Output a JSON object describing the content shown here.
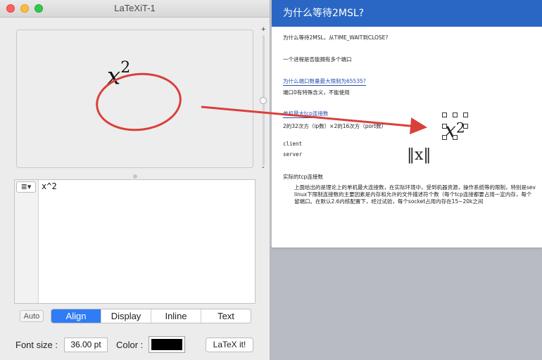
{
  "latexit": {
    "window_title": "LaTeXiT-1",
    "preview_formula_base": "x",
    "preview_formula_exponent": "2",
    "slider_plus": "+",
    "slider_minus": "-",
    "source_code": "x^2",
    "menu_glyph": "≣▾",
    "auto_label": "Auto",
    "modes": [
      "Align",
      "Display",
      "Inline",
      "Text"
    ],
    "active_mode": "Align",
    "font_size_label": "Font size :",
    "font_size_value": "36.00 pt",
    "color_label": "Color :",
    "color_value": "#000000",
    "latex_button": "LaTeX it!"
  },
  "document": {
    "title": "为什么等待2MSL?",
    "lines": {
      "l1": "为什么等待2MSL，从TIME_WAIT到CLOSE?",
      "l2": "一个进程是否能拥有多个端口",
      "l3": "为什么端口数量最大限制为65535?",
      "l4": "端口0有特殊含义，不能使用",
      "l5": "单机最大tcp连接数",
      "l6": "2的32次方（ip数）×2的16次方（port数）",
      "l7": "client",
      "l8": "server",
      "l9": "实际的tcp连接数",
      "p1": "上面给出的是理论上的单机最大连接数，在实际环境中，受到机器资源，操作系统等的限制，特别是sev",
      "p2": "linux下限制连接数的主要因素是内存和允许的文件描述符个数（每个tcp连接都要占用一定内存，每个",
      "p3": "留端口。在默认2.6内核配置下，经过试验，每个socket占用内存在15~20k之间"
    },
    "pasted_formula_base": "x",
    "pasted_formula_exponent": "2",
    "drag_glyph": "‖x‖"
  },
  "colors": {
    "accent": "#2f7cf6",
    "doc_header": "#2a67c4",
    "annotation": "#d9403a"
  }
}
